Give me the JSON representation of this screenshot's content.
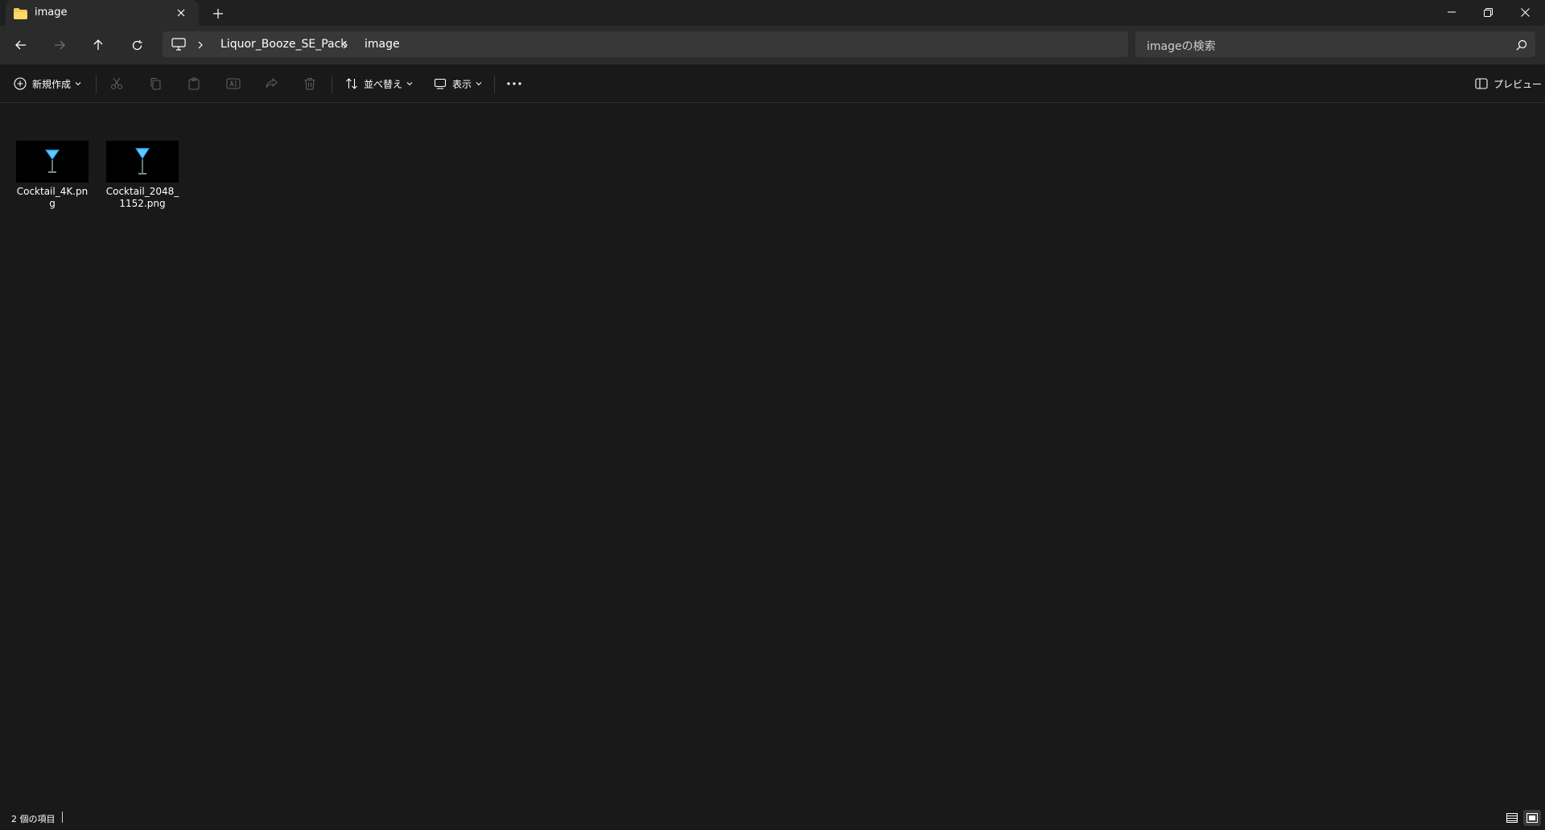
{
  "tab": {
    "title": "image",
    "folder_icon": "folder-icon",
    "close_icon": "close-icon"
  },
  "new_tab_icon": "plus-icon",
  "window_controls": [
    "minimize-icon",
    "restore-icon",
    "close-icon"
  ],
  "nav": {
    "buttons": [
      "back-arrow-icon",
      "forward-arrow-icon",
      "up-arrow-icon",
      "refresh-icon"
    ]
  },
  "address": {
    "root_icon": "computer-icon",
    "crumbs": [
      "Liquor_Booze_SE_Pack",
      "image"
    ]
  },
  "search": {
    "placeholder": "imageの検索",
    "icon": "search-icon"
  },
  "commandbar": {
    "new_label": "新規作成",
    "sort_label": "並べ替え",
    "view_label": "表示",
    "preview_label": "プレビュー",
    "disabled_icons": [
      "cut-icon",
      "copy-icon",
      "paste-icon",
      "rename-icon",
      "share-icon",
      "delete-icon"
    ]
  },
  "files": [
    {
      "name": "Cocktail_4K.png"
    },
    {
      "name": "Cocktail_2048_1152.png"
    }
  ],
  "status": {
    "item_count": "2 個の項目"
  },
  "colors": {
    "background": "#191919",
    "titlebar": "#202020",
    "address_bg": "#383838",
    "accent": "#4cc2ff",
    "folder": "#f2c94c"
  }
}
